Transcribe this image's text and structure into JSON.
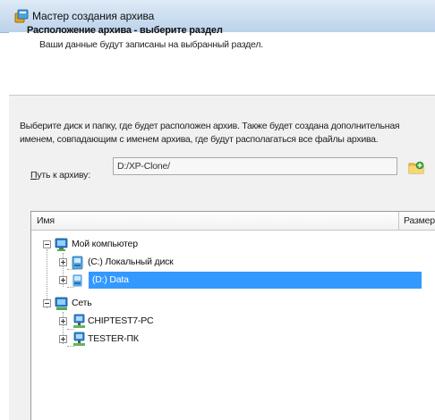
{
  "window": {
    "title": "Мастер создания архива"
  },
  "header": {
    "title": "Расположение архива - выберите раздел",
    "subtitle": "Ваши данные будут записаны на выбранный раздел."
  },
  "description": {
    "line1": "Выберите диск и папку, где будет расположен архив. Также будет создана дополнительная",
    "line2": "именем, совпадающим с именем архива, где будут располагаться все файлы архива."
  },
  "path": {
    "label_underlined": "П",
    "label_rest": "уть к архиву:",
    "value": "D:/XP-Clone/"
  },
  "tree": {
    "columns": {
      "name": "Имя",
      "size": "Размер"
    },
    "nodes": [
      {
        "label": "Мой компьютер",
        "icon": "computer-icon",
        "expanded": true
      },
      {
        "label": "(C:) Локальный диск",
        "icon": "drive-icon",
        "expanded": false
      },
      {
        "label": "(D:) Data",
        "icon": "drive-icon",
        "expanded": false,
        "selected": true
      },
      {
        "label": "Сеть",
        "icon": "network-icon",
        "expanded": true
      },
      {
        "label": "CHIPTEST7-PC",
        "icon": "network-computer-icon",
        "expanded": false
      },
      {
        "label": "TESTER-ПК",
        "icon": "network-computer-icon",
        "expanded": false
      }
    ]
  },
  "colors": {
    "selection": "#3399ff",
    "titlebar": "#c9dcef",
    "panel": "#f1f1f1"
  }
}
